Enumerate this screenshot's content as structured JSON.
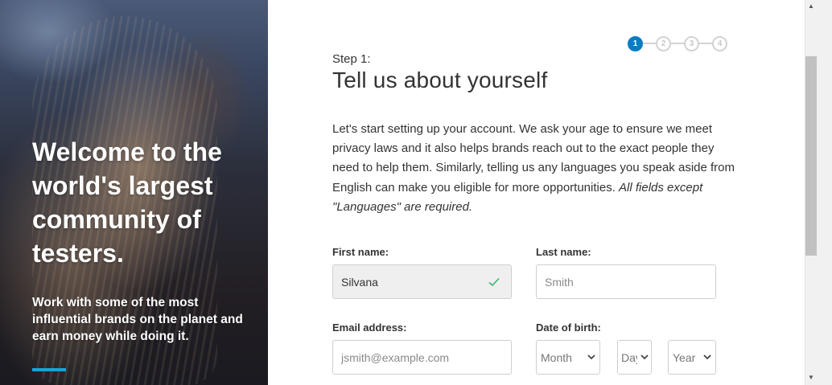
{
  "hero": {
    "title": "Welcome to the world's largest community of testers.",
    "subtitle": "Work with some of the most influential brands on the planet and earn money while doing it."
  },
  "stepper": {
    "steps": [
      "1",
      "2",
      "3",
      "4"
    ],
    "active": 1
  },
  "header": {
    "step_label": "Step 1:",
    "title": "Tell us about yourself"
  },
  "intro": {
    "text": "Let's start setting up your account. We ask your age to ensure we meet privacy laws and it also helps brands reach out to the exact people they need to help them. Similarly, telling us any languages you speak aside from English can make you eligible for more opportunities. ",
    "emphasis": "All fields except \"Languages\" are required."
  },
  "form": {
    "first_name": {
      "label": "First name:",
      "value": "Silvana"
    },
    "last_name": {
      "label": "Last name:",
      "placeholder": "Smith"
    },
    "email": {
      "label": "Email address:",
      "placeholder": "jsmith@example.com"
    },
    "dob": {
      "label": "Date of birth:",
      "month": "Month",
      "day": "Day",
      "year": "Year"
    }
  },
  "colors": {
    "accent": "#0a7cc4",
    "hero_bar": "#1ba1d8",
    "valid_check": "#3cb371"
  }
}
